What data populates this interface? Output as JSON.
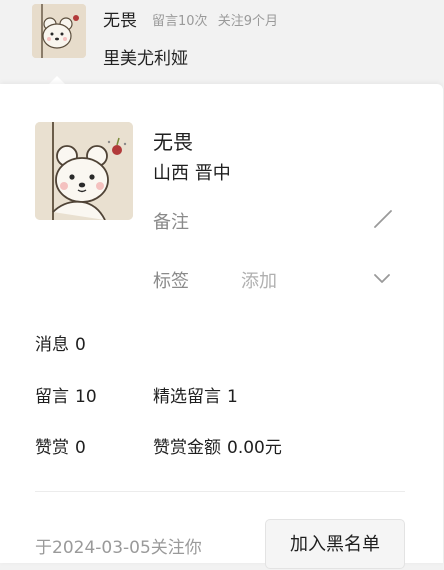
{
  "background_item": {
    "name": "无畏",
    "comment_count": "留言10次",
    "follow_duration": "关注9个月",
    "comment_text": "里美尤利娅"
  },
  "profile": {
    "name": "无畏",
    "region": "山西 晋中",
    "remark_label": "备注",
    "tag_label": "标签",
    "tag_add": "添加",
    "icons": {
      "edit": "pencil-icon",
      "expand": "chevron-down-icon"
    }
  },
  "stats": {
    "messages": {
      "label": "消息",
      "value": "0"
    },
    "comments": {
      "label": "留言",
      "value": "10"
    },
    "featured": {
      "label": "精选留言",
      "value": "1"
    },
    "rewards": {
      "label": "赞赏",
      "value": "0"
    },
    "reward_amount": {
      "label": "赞赏金额",
      "value": "0.00元"
    }
  },
  "footer": {
    "follow_date": "于2024-03-05关注你",
    "blacklist_button": "加入黑名单"
  }
}
